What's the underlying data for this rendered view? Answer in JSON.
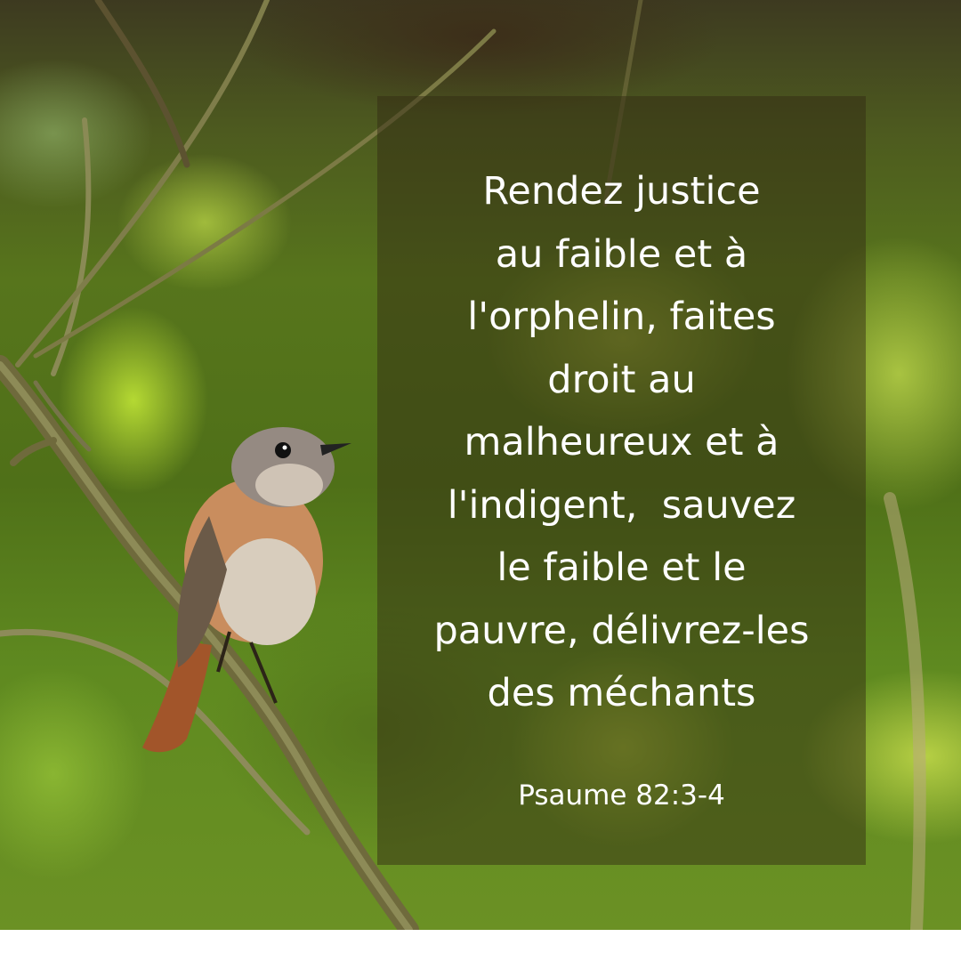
{
  "verse": {
    "lines": [
      "Rendez justice",
      "au faible et à",
      "l'orphelin, faites",
      "droit au",
      "malheureux et à",
      "l'indigent,  sauvez",
      "le faible et le",
      "pauvre, délivrez-les",
      "des méchants"
    ],
    "reference": "Psaume 82:3-4"
  },
  "colors": {
    "text": "#ffffff",
    "panel": "#322a12",
    "footer": "#ffffff"
  }
}
